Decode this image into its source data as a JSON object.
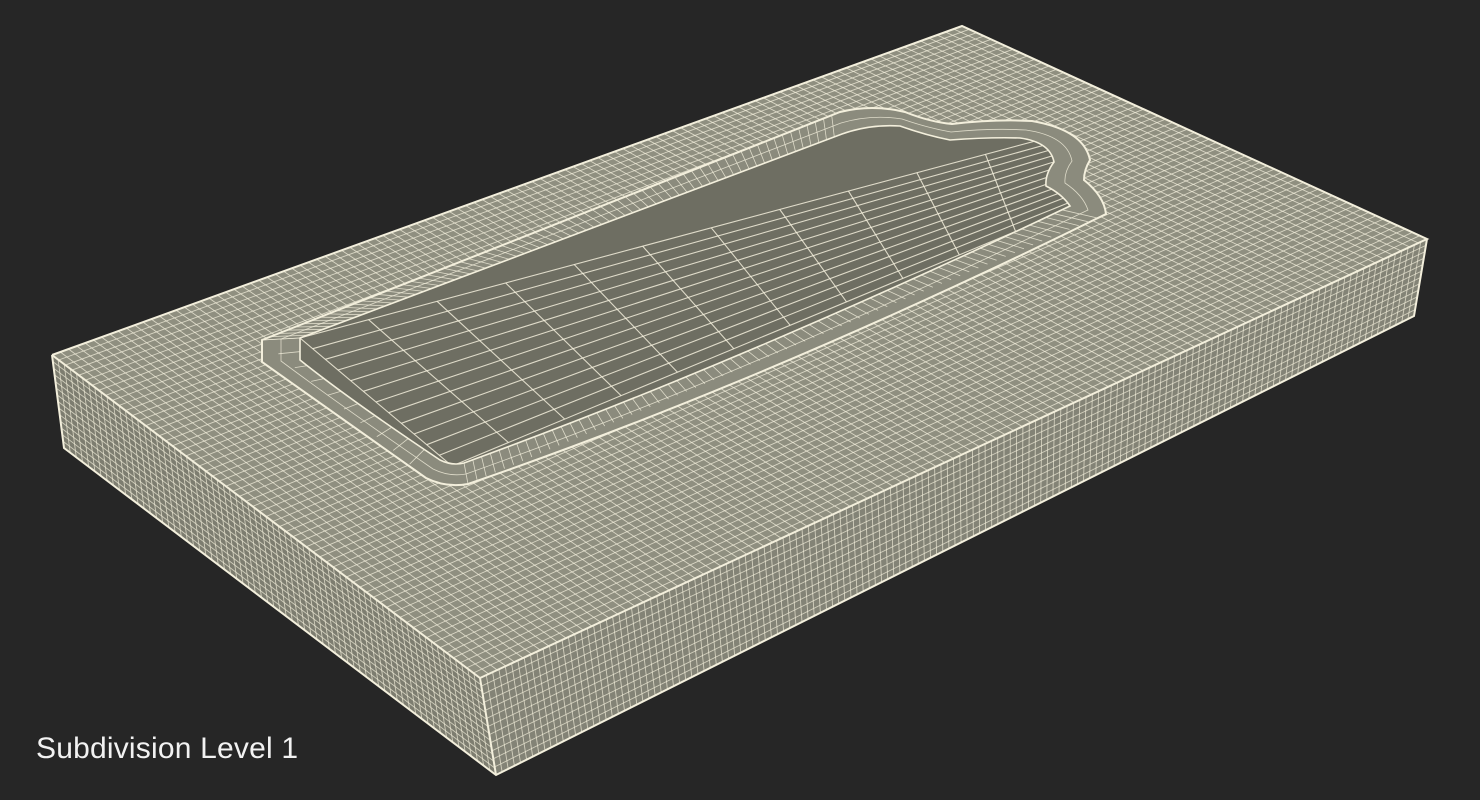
{
  "caption": "Subdivision Level 1",
  "colors": {
    "background": "#262626",
    "mesh_face_top": "#8f8f80",
    "mesh_face_side": "#7d7d70",
    "mesh_face_pool": "#6e6e62",
    "wire": "#f3efdc",
    "caption_text": "#f2f2f2"
  }
}
